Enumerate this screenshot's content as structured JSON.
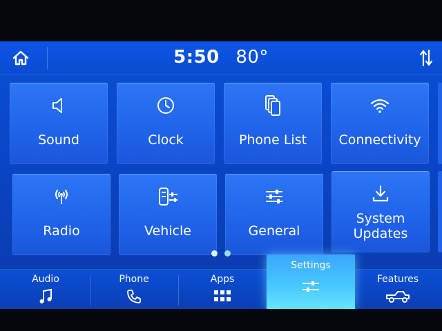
{
  "status": {
    "time": "5:50",
    "temperature": "80°"
  },
  "header": {
    "home_icon": "home-icon",
    "sort_icon": "sort-arrows-icon"
  },
  "tiles": [
    {
      "label": "Sound",
      "icon": "speaker-icon"
    },
    {
      "label": "Clock",
      "icon": "clock-icon"
    },
    {
      "label": "Phone List",
      "icon": "phone-list-icon"
    },
    {
      "label": "Connectivity",
      "icon": "wifi-icon"
    },
    {
      "label": "Radio",
      "icon": "radio-antenna-icon"
    },
    {
      "label": "Vehicle",
      "icon": "vehicle-settings-icon"
    },
    {
      "label": "General",
      "icon": "sliders-icon"
    },
    {
      "label": "System Updates",
      "icon": "download-icon"
    }
  ],
  "pager": {
    "pages": 2,
    "current": 1
  },
  "nav": [
    {
      "label": "Audio",
      "icon": "music-note-icon"
    },
    {
      "label": "Phone",
      "icon": "phone-icon"
    },
    {
      "label": "Apps",
      "icon": "grid-icon"
    },
    {
      "label": "Settings",
      "icon": "settings-sliders-icon",
      "active": true
    },
    {
      "label": "Features",
      "icon": "truck-icon"
    }
  ],
  "colors": {
    "accent": "#46c7ff",
    "background": "#0a45c6",
    "tile": "#2669ee"
  }
}
